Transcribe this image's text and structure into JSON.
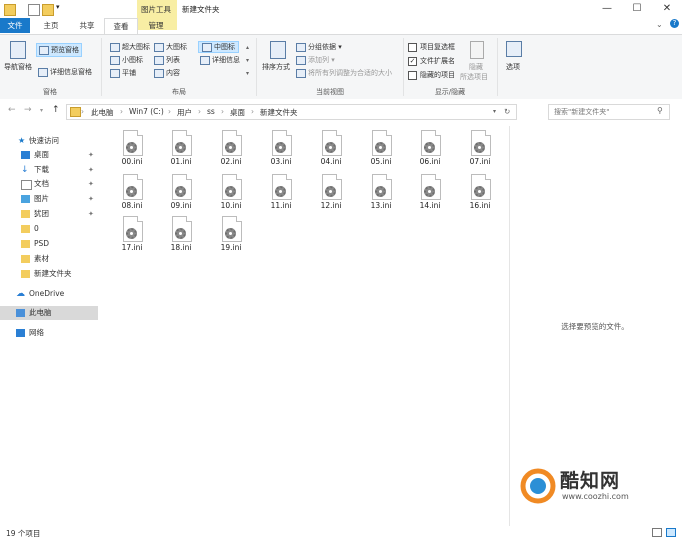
{
  "titlebar": {
    "context_tab": "图片工具",
    "title": "新建文件夹",
    "minimize_icon": "—",
    "maximize_icon": "☐",
    "close_icon": "✕"
  },
  "tabs": [
    "文件",
    "主页",
    "共享",
    "查看",
    "管理"
  ],
  "ribbon": {
    "panes": {
      "nav_pane": "导航窗格",
      "preview_pane": "预览窗格",
      "details_pane": "详细信息窗格",
      "label": "窗格"
    },
    "layout": {
      "extra_large": "超大图标",
      "large": "大图标",
      "medium": "中图标",
      "small": "小图标",
      "list": "列表",
      "details": "详细信息",
      "tiles": "平铺",
      "content": "内容",
      "label": "布局"
    },
    "current_view": {
      "sort": "排序方式",
      "group_by": "分组依据",
      "add_columns": "添加列",
      "size_columns": "将所有列调整为合适的大小",
      "label": "当前视图"
    },
    "show_hide": {
      "item_checkboxes": "项目复选框",
      "file_extensions": "文件扩展名",
      "hidden_items": "隐藏的项目",
      "hide_selected": "隐藏",
      "hide_selected2": "所选项目",
      "label": "显示/隐藏",
      "item_checkboxes_checked": false,
      "file_extensions_checked": true,
      "hidden_items_checked": false
    },
    "options": "选项"
  },
  "address": {
    "crumbs": [
      "此电脑",
      "Win7 (C:)",
      "用户",
      "ss",
      "桌面",
      "新建文件夹"
    ],
    "search_placeholder": "搜索\"新建文件夹\""
  },
  "sidebar": {
    "quick_access": "快速访问",
    "items": [
      "桌面",
      "下载",
      "文档",
      "图片",
      "犹团",
      "0",
      "PSD",
      "素材",
      "新建文件夹"
    ],
    "onedrive": "OneDrive",
    "this_pc": "此电脑",
    "network": "网络"
  },
  "files": [
    "00.ini",
    "01.ini",
    "02.ini",
    "03.ini",
    "04.ini",
    "05.ini",
    "06.ini",
    "07.ini",
    "08.ini",
    "09.ini",
    "10.ini",
    "11.ini",
    "12.ini",
    "13.ini",
    "14.ini",
    "16.ini",
    "17.ini",
    "18.ini",
    "19.ini"
  ],
  "preview": {
    "empty_text": "选择要预览的文件。"
  },
  "watermark": {
    "brand": "酷知网",
    "url": "www.coozhi.com"
  },
  "status": {
    "count": "19 个项目"
  },
  "colors": {
    "accent": "#1979ca",
    "context": "#f8eea4",
    "selected": "#cce8ff"
  }
}
